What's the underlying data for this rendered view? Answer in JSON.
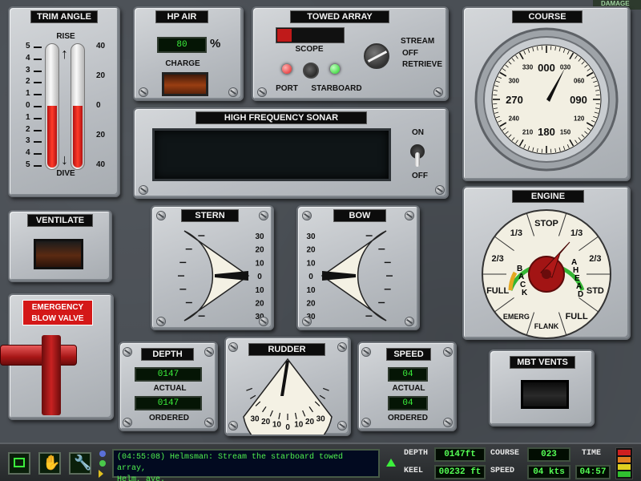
{
  "damage": {
    "label": "DAMAGE"
  },
  "trim_angle": {
    "title": "TRIM ANGLE",
    "rise_label": "RISE",
    "dive_label": "DIVE",
    "left_scale": [
      "5",
      "4",
      "3",
      "2",
      "1",
      "0",
      "1",
      "2",
      "3",
      "4",
      "5"
    ],
    "right_scale": [
      "40",
      "20",
      "0",
      "20",
      "40"
    ],
    "level_fraction": 0.5
  },
  "hp_air": {
    "title": "HP AIR",
    "value": "80",
    "unit": "%",
    "charge_label": "CHARGE"
  },
  "towed_array": {
    "title": "TOWED ARRAY",
    "scope_label": "SCOPE",
    "port_label": "PORT",
    "starboard_label": "STARBOARD",
    "stream_label": "STREAM",
    "off_label": "OFF",
    "retrieve_label": "RETRIEVE",
    "port_color": "#e02020",
    "starboard_color": "#20d020"
  },
  "course": {
    "title": "COURSE",
    "heading": "000",
    "dial_labels": [
      "000",
      "030",
      "060",
      "090",
      "120",
      "150",
      "180",
      "210",
      "240",
      "270",
      "300",
      "330"
    ]
  },
  "sonar": {
    "title": "HIGH FREQUENCY SONAR",
    "on_label": "ON",
    "off_label": "OFF"
  },
  "ventilate": {
    "title": "VENTILATE"
  },
  "stern": {
    "title": "STERN",
    "scale": [
      "30",
      "20",
      "10",
      "0",
      "10",
      "20",
      "30"
    ]
  },
  "bow": {
    "title": "BOW",
    "scale": [
      "30",
      "20",
      "10",
      "0",
      "10",
      "20",
      "30"
    ]
  },
  "engine": {
    "title": "ENGINE",
    "labels": [
      "STOP",
      "1/3",
      "2/3",
      "STD",
      "FULL",
      "FLANK",
      "EMERG",
      "FULL",
      "2/3",
      "1/3"
    ],
    "back_label": "BACK",
    "ahead_label": "AHEAD",
    "setting": "1/3 AHEAD"
  },
  "emergency_blow": {
    "label_line1": "EMERGENCY",
    "label_line2": "BLOW VALVE"
  },
  "depth": {
    "title": "DEPTH",
    "actual": "0147",
    "actual_label": "ACTUAL",
    "ordered": "0147",
    "ordered_label": "ORDERED"
  },
  "rudder": {
    "title": "RUDDER",
    "scale": [
      "30",
      "20",
      "10",
      "0",
      "10",
      "20",
      "30"
    ]
  },
  "speed": {
    "title": "SPEED",
    "actual": "04",
    "actual_label": "ACTUAL",
    "ordered": "04",
    "ordered_label": "ORDERED"
  },
  "mbt_vents": {
    "title": "MBT VENTS"
  },
  "status_bar": {
    "message_line1": "(04:55:08) Helmsman: Stream the starboard towed array,",
    "message_line2": "Helm, aye.",
    "depth_label": "DEPTH",
    "depth_value": "0147ft",
    "keel_label": "KEEL",
    "keel_value": "00232 ft",
    "course_label": "COURSE",
    "course_value": "023",
    "speed_label": "SPEED",
    "speed_value": "04 kts",
    "time_label": "TIME",
    "time_value": "04:57"
  }
}
